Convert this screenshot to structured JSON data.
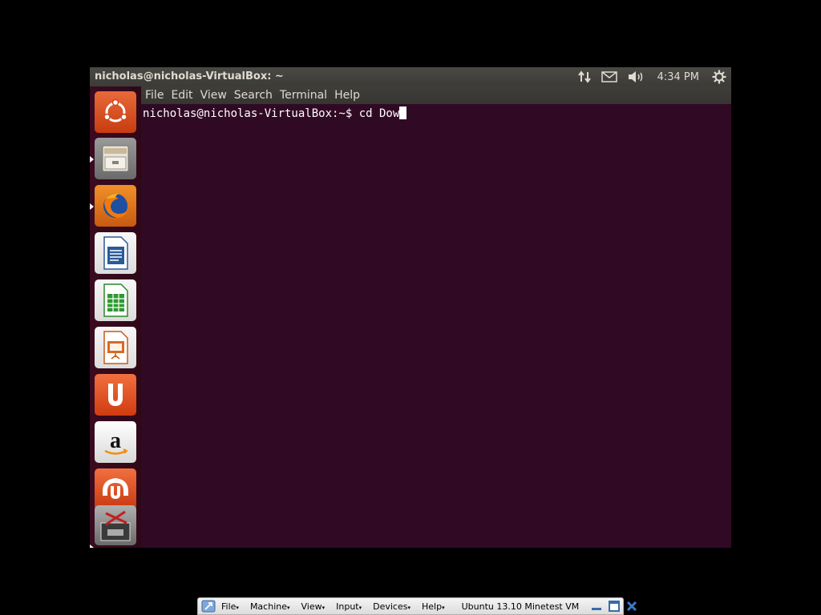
{
  "top_panel": {
    "window_title": "nicholas@nicholas-VirtualBox: ~",
    "clock": "4:34 PM",
    "icons": [
      "network-updown-icon",
      "mail-icon",
      "volume-icon",
      "gear-icon"
    ]
  },
  "menubar": {
    "items": [
      "File",
      "Edit",
      "View",
      "Search",
      "Terminal",
      "Help"
    ]
  },
  "launcher": {
    "items": [
      {
        "name": "ubuntu-dash-icon",
        "bg": "#dd4814"
      },
      {
        "name": "files-icon",
        "bg": "#7a7a7a"
      },
      {
        "name": "firefox-icon",
        "bg": "#e66000"
      },
      {
        "name": "libreoffice-writer-icon",
        "bg": "#ffffff"
      },
      {
        "name": "libreoffice-calc-icon",
        "bg": "#ffffff"
      },
      {
        "name": "libreoffice-impress-icon",
        "bg": "#ffffff"
      },
      {
        "name": "ubuntu-software-center-icon",
        "bg": "#e95420"
      },
      {
        "name": "amazon-icon",
        "bg": "#eeeeee"
      },
      {
        "name": "ubuntu-one-icon",
        "bg": "#e95420"
      },
      {
        "name": "workspace-switcher-icon",
        "bg": "#888888"
      }
    ]
  },
  "terminal": {
    "prompt": "nicholas@nicholas-VirtualBox:~$ ",
    "command": "cd Dow"
  },
  "vbox_bar": {
    "menus": [
      "File",
      "Machine",
      "View",
      "Input",
      "Devices",
      "Help"
    ],
    "title": "Ubuntu 13.10 Minetest VM"
  },
  "colors": {
    "terminal_bg": "#300a24",
    "panel_bg": "#3c3b37",
    "ubuntu_orange": "#e95420"
  }
}
